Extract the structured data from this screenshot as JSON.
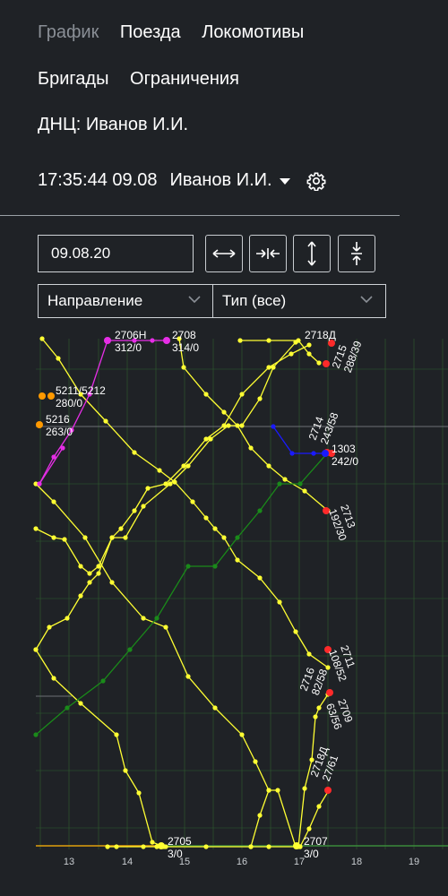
{
  "nav": {
    "row1": [
      {
        "label": "График",
        "active": true
      },
      {
        "label": "Поезда",
        "active": false
      },
      {
        "label": "Локомотивы",
        "active": false
      }
    ],
    "row2": [
      {
        "label": "Бригады",
        "active": false
      },
      {
        "label": "Ограничения",
        "active": false
      }
    ]
  },
  "dnc": "ДНЦ: Иванов И.И.",
  "status": {
    "datetime": "17:35:44 09.08",
    "user": "Иванов И.И."
  },
  "icons": {
    "settings": "gear-icon",
    "user_menu": "caret-down-icon"
  },
  "controls": {
    "date": "09.08.20",
    "direction": "Направление",
    "type": "Тип (все)"
  },
  "colors": {
    "background": "#1f2226",
    "passenger": "#ffff33",
    "suburban": "#e62ee6",
    "freight": "#1a8a1a",
    "special": "#1a1aff",
    "station_origin": "#ff9900",
    "train_end": "#ff2a2a",
    "grid": "#2f5f2f"
  },
  "chart_data": {
    "type": "line",
    "x_ticks": [
      "13",
      "14",
      "15",
      "16",
      "17",
      "18",
      "19"
    ],
    "train_labels": [
      {
        "train": "2706Н",
        "info": "312/0"
      },
      {
        "train": "2708",
        "info": "314/0"
      },
      {
        "train": "5211/5212",
        "info": "280/0"
      },
      {
        "train": "5216",
        "info": "263/0"
      },
      {
        "train": "2718Д",
        "info": ""
      },
      {
        "train": "2715",
        "info": "288/39"
      },
      {
        "train": "2714",
        "info": "243/58"
      },
      {
        "train": "1303",
        "info": "242/0"
      },
      {
        "train": "2713",
        "info": "192/30"
      },
      {
        "train": "2711",
        "info": "108/52"
      },
      {
        "train": "2716",
        "info": "82/58"
      },
      {
        "train": "2709",
        "info": "63/56"
      },
      {
        "train": "2718Д",
        "info": "27/61"
      },
      {
        "train": "2705",
        "info": "3/0"
      },
      {
        "train": "2707",
        "info": "3/0"
      }
    ]
  }
}
